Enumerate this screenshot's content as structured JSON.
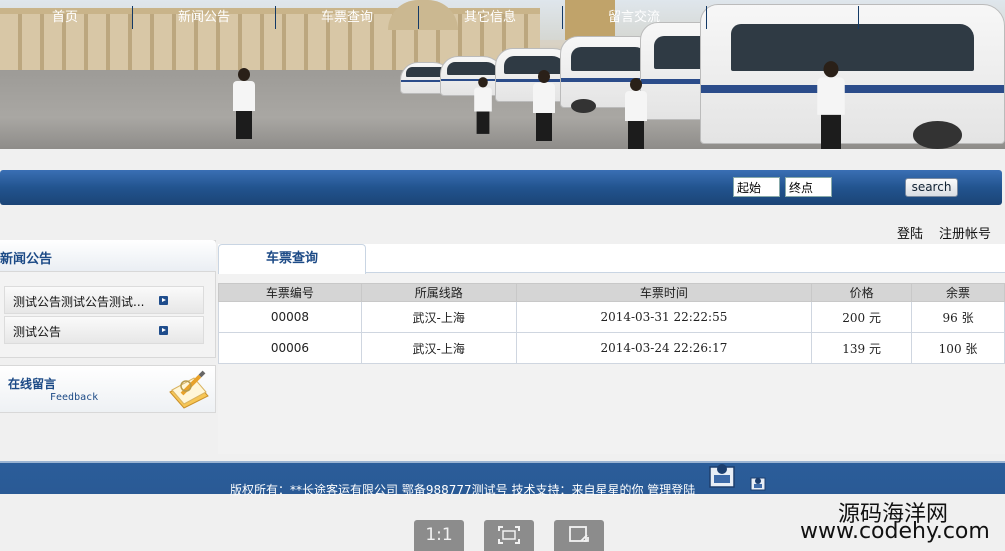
{
  "nav": {
    "items": [
      "首页",
      "新闻公告",
      "车票查询",
      "其它信息",
      "留言交流"
    ],
    "from_value": "起始",
    "to_value": "终点",
    "search_label": "search"
  },
  "auth": {
    "login": "登陆",
    "register": "注册帐号"
  },
  "sidebar": {
    "title": "新闻公告",
    "items": [
      "测试公告测试公告测试...",
      "测试公告"
    ],
    "feedback_cn": "在线留言",
    "feedback_en": "Feedback"
  },
  "main": {
    "tab": "车票查询",
    "columns": [
      "车票编号",
      "所属线路",
      "车票时间",
      "价格",
      "余票"
    ],
    "rows": [
      [
        "00008",
        "武汉-上海",
        "2014-03-31 22:22:55",
        "200 元",
        "96 张"
      ],
      [
        "00006",
        "武汉-上海",
        "2014-03-24 22:26:17",
        "139 元",
        "100 张"
      ]
    ]
  },
  "footer": {
    "text": "版权所有：**长途客运有限公司   鄂备988777测试号  技术支持：来自星星的你    管理登陆"
  },
  "viewer": {
    "btn1": "1:1",
    "btn2": "⛶",
    "btn3": "⎘"
  },
  "watermark": {
    "line1": "源码海洋网",
    "line2": "www.codehy.com"
  }
}
